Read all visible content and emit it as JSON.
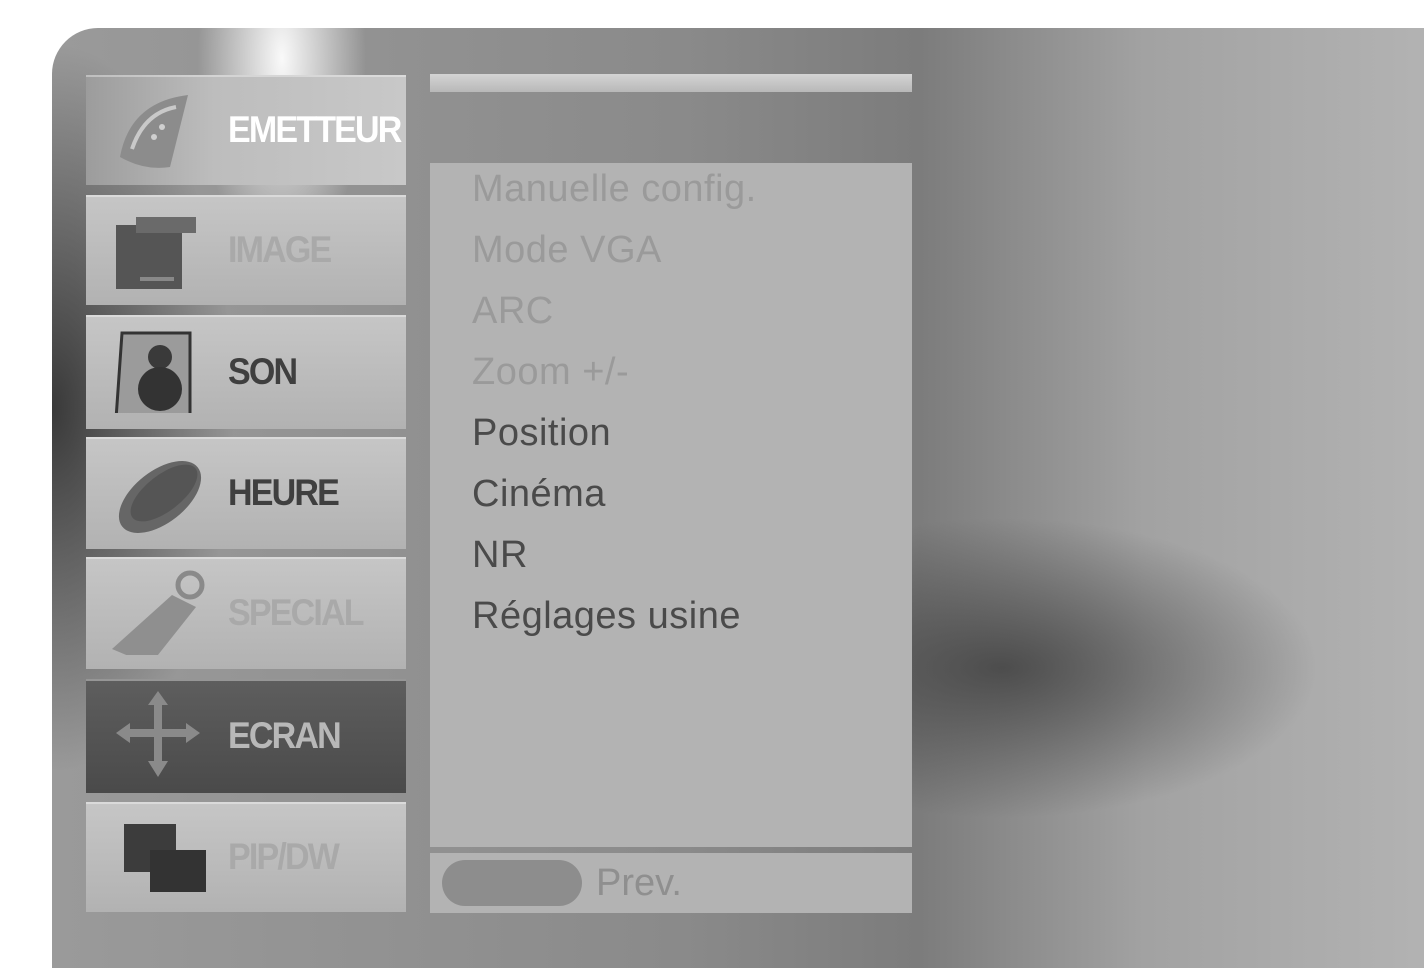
{
  "menu": {
    "items": [
      {
        "label": "EMETTEUR",
        "icon": "satellite-dish-icon",
        "state": "selected"
      },
      {
        "label": "IMAGE",
        "icon": "monitor-icon",
        "state": "normal"
      },
      {
        "label": "SON",
        "icon": "speaker-icon",
        "state": "normal"
      },
      {
        "label": "HEURE",
        "icon": "clock-icon",
        "state": "normal"
      },
      {
        "label": "SPECIAL",
        "icon": "tag-icon",
        "state": "normal"
      },
      {
        "label": "ECRAN",
        "icon": "move-arrows-icon",
        "state": "active"
      },
      {
        "label": "PIP/DW",
        "icon": "pip-window-icon",
        "state": "normal"
      }
    ]
  },
  "submenu": {
    "items": [
      "Manuelle config.",
      "Mode VGA",
      "ARC",
      "Zoom +/-",
      "Position",
      "Cinéma",
      "NR",
      "Réglages usine"
    ]
  },
  "footer": {
    "prev_label": "Prev."
  }
}
